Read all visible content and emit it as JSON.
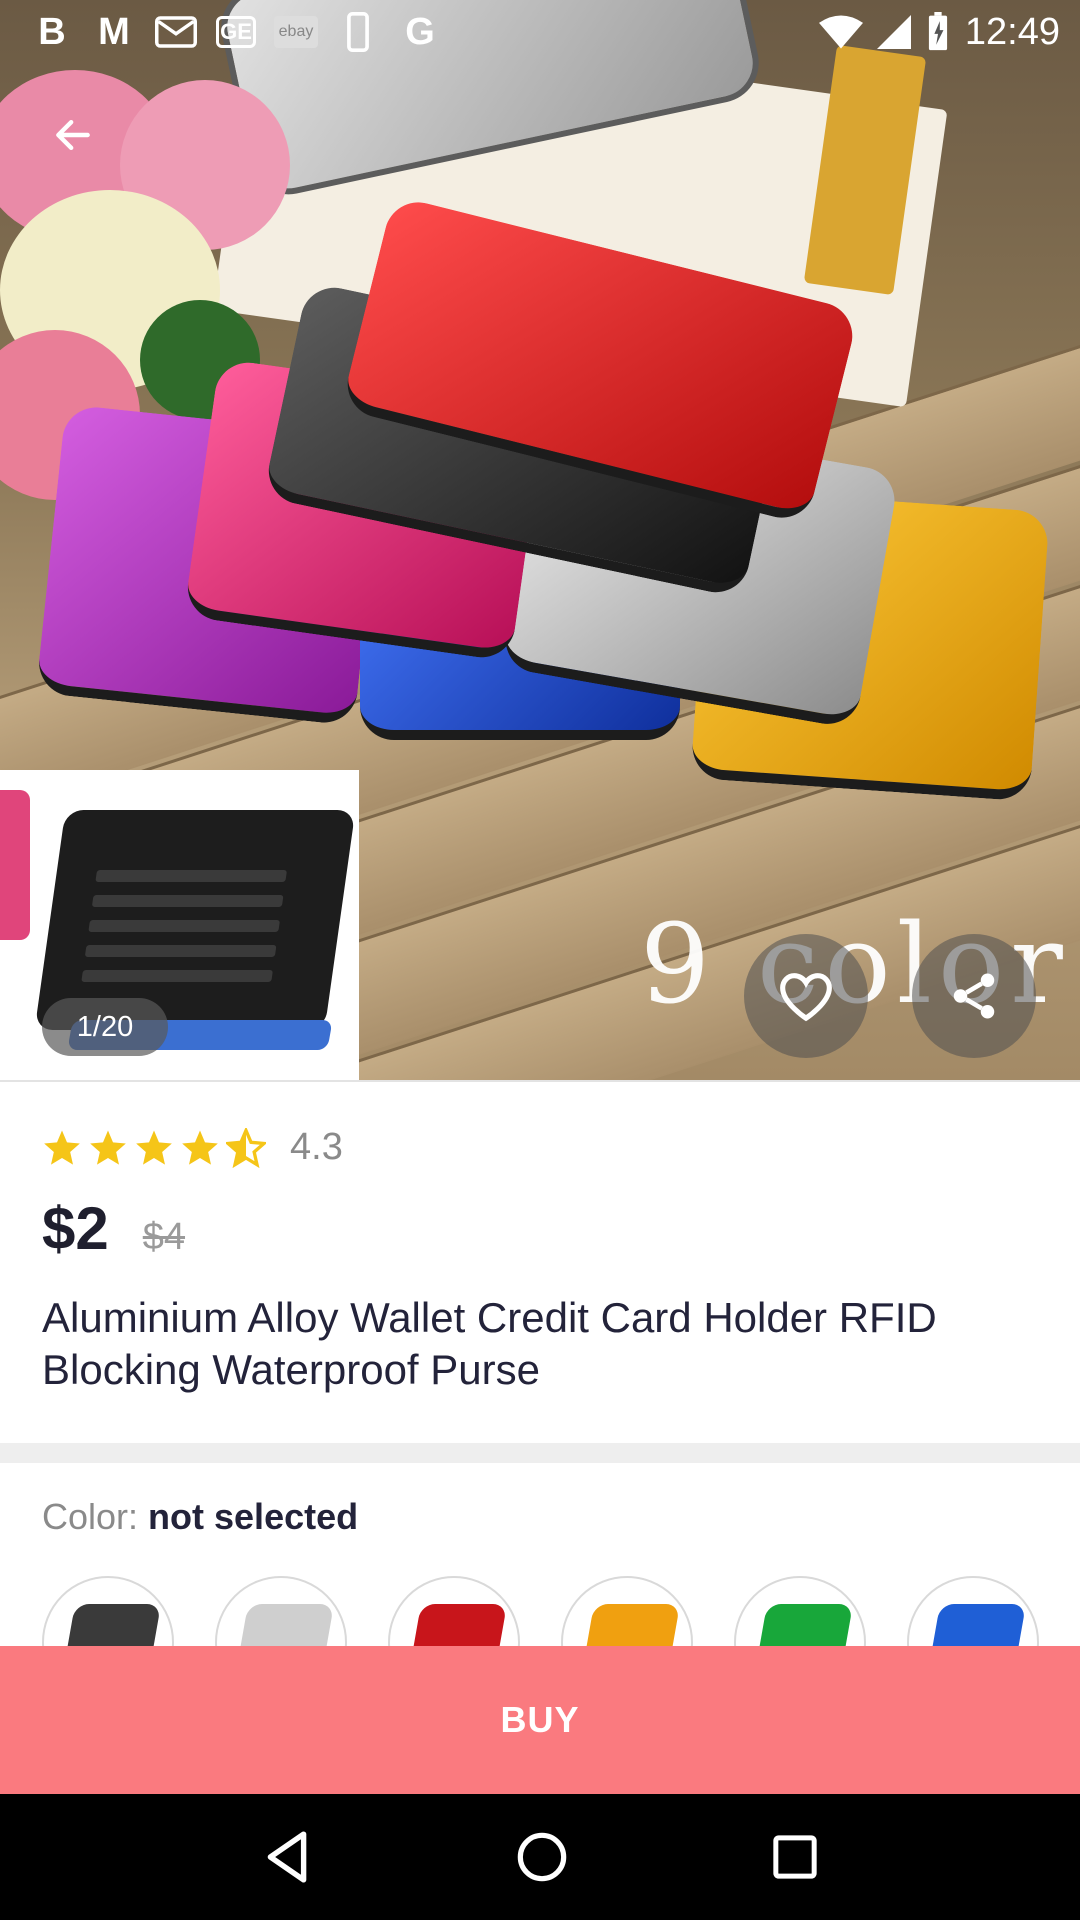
{
  "status_bar": {
    "time": "12:49",
    "notification_icons": [
      "B",
      "M",
      "gmail-icon",
      "GE",
      "ebay",
      "phone-icon",
      "G"
    ],
    "ebay_label": "ebay"
  },
  "gallery": {
    "counter": "1/20",
    "overlay_text": "9 color"
  },
  "product": {
    "rating": "4.3",
    "rating_fraction": 0.86,
    "price": "$2",
    "old_price": "$4",
    "title": "Aluminium Alloy Wallet Credit Card Holder RFID Blocking Waterproof Purse"
  },
  "color_selector": {
    "label": "Color:",
    "value": "not selected",
    "swatches": [
      {
        "color": "#3a3a3a"
      },
      {
        "color": "#cfcfcf"
      },
      {
        "color": "#c8151b"
      },
      {
        "color": "#f0a010"
      },
      {
        "color": "#18a73a"
      },
      {
        "color": "#1f5fd6"
      }
    ]
  },
  "buy_button": {
    "label": "BUY"
  },
  "colors": {
    "accent": "#fa7a7f",
    "star": "#f5c518"
  }
}
